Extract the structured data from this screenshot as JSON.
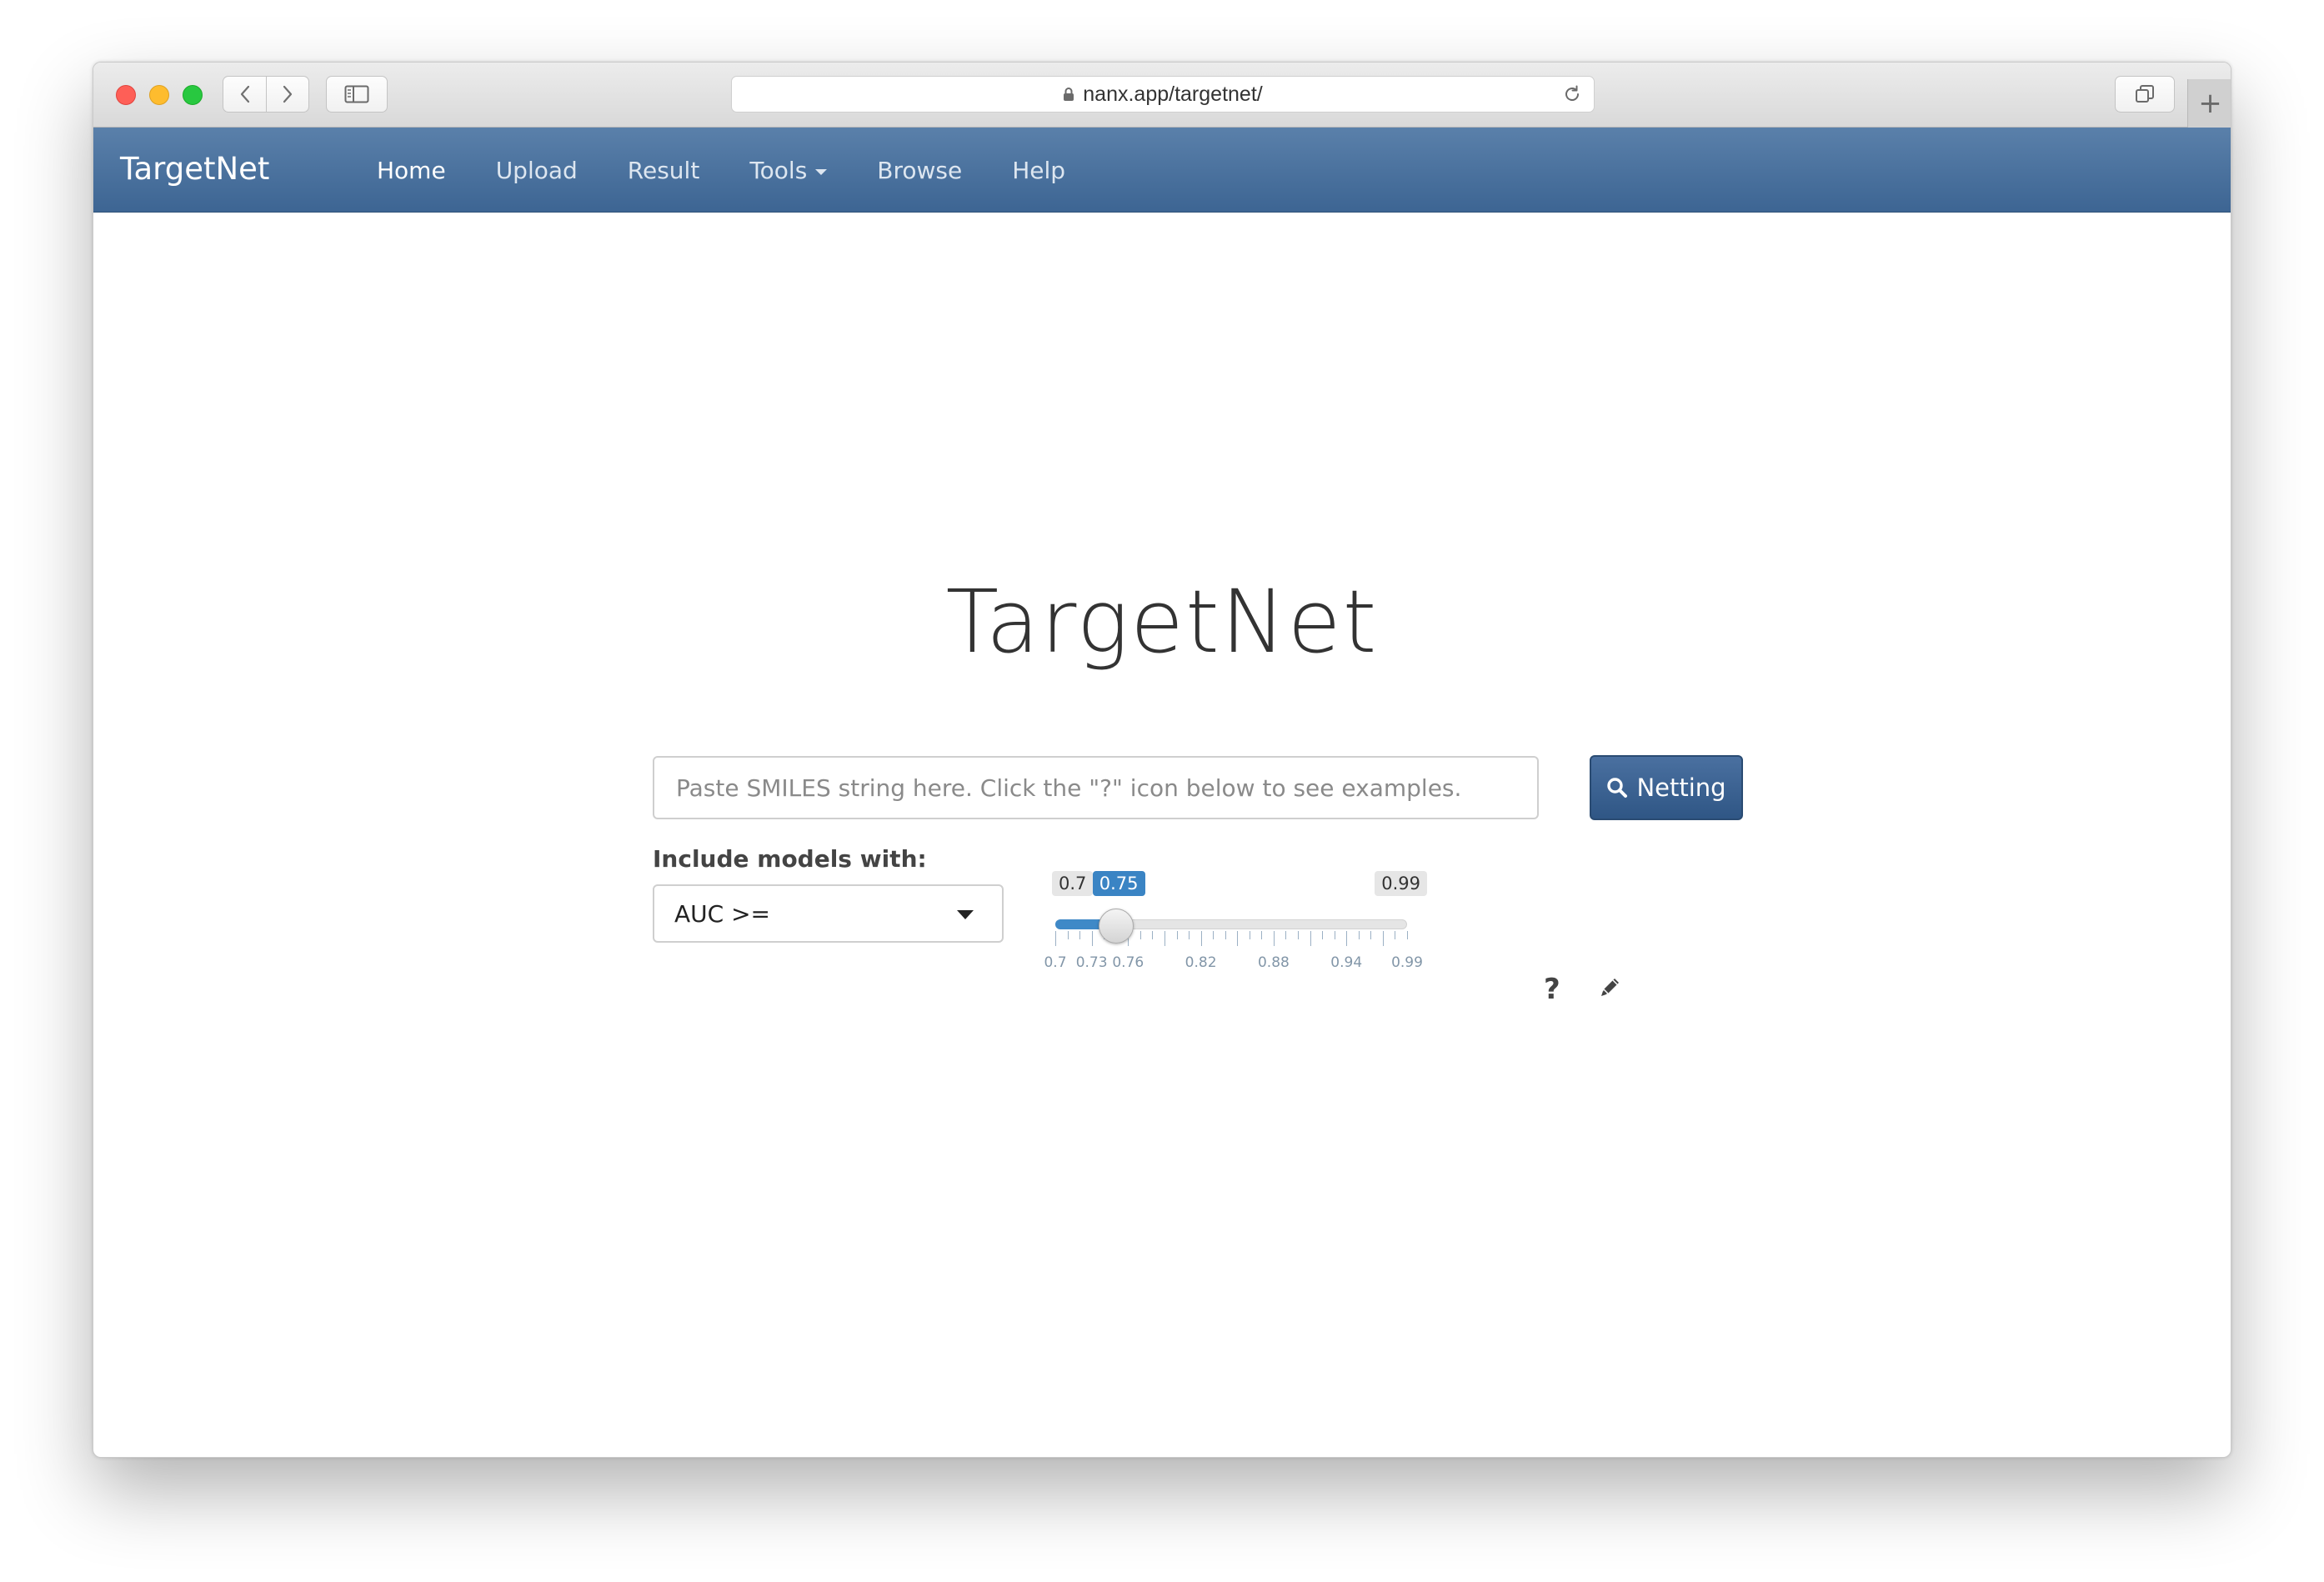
{
  "browser": {
    "url": "nanx.app/targetnet/"
  },
  "navbar": {
    "brand": "TargetNet",
    "links": [
      {
        "label": "Home"
      },
      {
        "label": "Upload"
      },
      {
        "label": "Result"
      },
      {
        "label": "Tools"
      },
      {
        "label": "Browse"
      },
      {
        "label": "Help"
      }
    ],
    "active": "Home"
  },
  "main": {
    "title": "TargetNet",
    "search": {
      "placeholder": "Paste SMILES string here. Click the \"?\" icon below to see examples.",
      "value": ""
    },
    "submit_label": "Netting",
    "include_label": "Include models with:",
    "metric_select": {
      "selected": "AUC >="
    },
    "slider": {
      "min_label": "0.7",
      "max_label": "0.99",
      "value_label": "0.75",
      "min": 0.7,
      "max": 0.99,
      "value": 0.75,
      "tick_labels": [
        "0.7",
        "0.73",
        "0.76",
        "0.82",
        "0.88",
        "0.94",
        "0.99"
      ],
      "tick_values": [
        0.7,
        0.73,
        0.76,
        0.82,
        0.88,
        0.94,
        0.99
      ]
    },
    "help_text": "?"
  },
  "colors": {
    "navbar": "#3d6593",
    "primary_button": "#2f5685",
    "slider_accent": "#3a84c4"
  }
}
